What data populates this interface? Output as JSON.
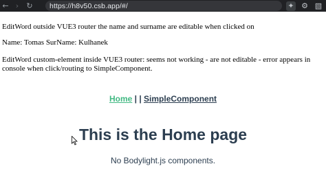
{
  "browser": {
    "url": "https://h8v50.csb.app/#/",
    "icons": [
      "back-icon",
      "forward-icon",
      "reload-icon",
      "extension-icon",
      "settings-icon",
      "extensions-puzzle-icon"
    ]
  },
  "page": {
    "line1": "EditWord outside VUE3 router the name and surname are editable when clicked on",
    "name_label": "Name:",
    "name_value": "Tomas",
    "surname_label": "SurName:",
    "surname_value": "Kulhanek",
    "line3": "EditWord custom-element inside VUE3 router: seems not working - are not editable - error appears in console when click/routing to SimpleComponent.",
    "nav": {
      "home": "Home",
      "separator": " | | ",
      "simple": "SimpleComponent"
    },
    "heading": "This is the Home page",
    "subtext": "No Bodylight.js components."
  },
  "colors": {
    "accent": "#42b983",
    "text": "#2c3e50",
    "toolbar": "#202124"
  }
}
